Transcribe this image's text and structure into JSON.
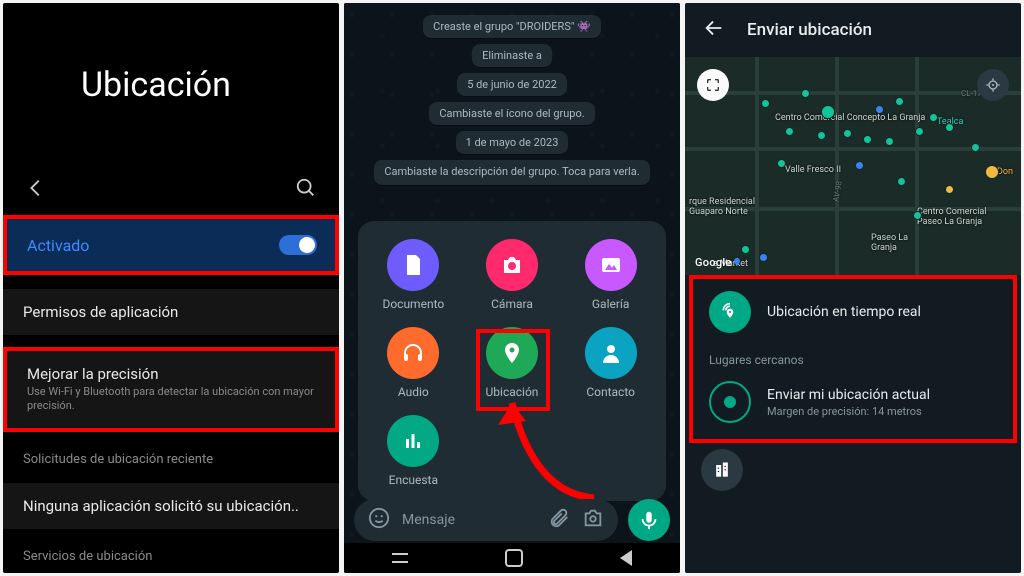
{
  "panel1": {
    "title": "Ubicación",
    "activated": "Activado",
    "perms": "Permisos de aplicación",
    "improve_title": "Mejorar la precisión",
    "improve_sub": "Use Wi-Fi y Bluetooth para detectar la ubicación con mayor precisión.",
    "recent_section": "Solicitudes de ubicación reciente",
    "recent_none": "Ninguna aplicación solicitó su ubicación..",
    "services_section": "Servicios de ubicación"
  },
  "panel2": {
    "chips": {
      "created": "Creaste el grupo \"DROIDERS\" 👾",
      "removed": "Eliminaste a",
      "date1": "5 de junio de 2022",
      "icon_changed": "Cambiaste el ícono del grupo.",
      "date2": "1 de mayo de 2023",
      "desc_changed": "Cambiaste la descripción del grupo. Toca para verla."
    },
    "attach": {
      "document": "Documento",
      "camera": "Cámara",
      "gallery": "Galería",
      "audio": "Audio",
      "location": "Ubicación",
      "contact": "Contacto",
      "poll": "Encuesta"
    },
    "input_placeholder": "Mensaje"
  },
  "panel3": {
    "title": "Enviar ubicación",
    "map_labels": {
      "cc": "Centro Comercial Concepto La Granja",
      "tealca": "Tealca",
      "valle": "Valle Fresco II",
      "don": "Don",
      "parque": "rque Residencial Guaparo Norte",
      "paseo": "Centro Comercial Paseo La Granja",
      "paseo2": "Paseo La Granja",
      "market": "e Market",
      "cl175": "CL-175-A",
      "av98": "AV-98"
    },
    "google": "Google",
    "live": "Ubicación en tiempo real",
    "nearby": "Lugares cercanos",
    "send_current": "Enviar mi ubicación actual",
    "accuracy": "Margen de precisión: 14 metros"
  }
}
